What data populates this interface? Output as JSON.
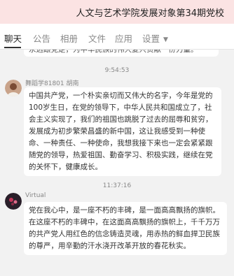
{
  "header": {
    "title": "人文与艺术学院发展对象第34期党校"
  },
  "tabs": [
    {
      "label": "聊天"
    },
    {
      "label": "公告"
    },
    {
      "label": "相册"
    },
    {
      "label": "文件"
    },
    {
      "label": "应用"
    },
    {
      "label": "设置"
    }
  ],
  "messages": {
    "partial_text": "永远跟党走，为中华民族的伟大复兴贡献一份力量。",
    "time1": "9:54:53",
    "msg1": {
      "sender": "舞蹈学81801 胡南",
      "text": "中国共产党，一个朴实亲切而又伟大的名字，今年是党的100岁生日，在党的领导下，中华人民共和国成立了，社会主义实现了，我们的祖国也跳脱了过去的屈辱和贫穷，发展成为初步繁荣昌盛的新中国，这让我感受到一种使命、一种责任、一种使命，我想我接下来也一定会紧紧跟随党的领导，热爱祖国、勤奋学习、积极实践，继续在党的关怀下，健康成长。"
    },
    "time2": "11:37:16",
    "msg2": {
      "sender": "Virtual",
      "text": "党在我心中，是一座不朽的丰碑，是一面高高飘扬的旗帜。在这座不朽的丰碑中，在这面高高飘扬的旗帜上，千千万万的共产党人用红色的信念铸造灵魂，用赤热的鲜血捍卫民族的尊严，用辛勤的汗水浇开改革开放的春花秋实。"
    }
  }
}
